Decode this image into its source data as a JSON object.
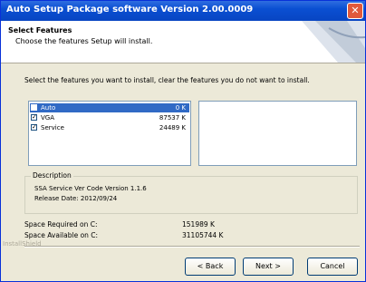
{
  "window": {
    "title": "Auto Setup Package software Version 2.00.0009"
  },
  "header": {
    "title": "Select Features",
    "subtitle": "Choose the features Setup will install."
  },
  "instructions": "Select the features you want to install, clear the features you do not want to install.",
  "features": [
    {
      "label": "Auto",
      "size": "0 K",
      "checked": false,
      "selected": true
    },
    {
      "label": "VGA",
      "size": "87537 K",
      "checked": true,
      "selected": false
    },
    {
      "label": "Service",
      "size": "24489 K",
      "checked": true,
      "selected": false
    }
  ],
  "description": {
    "legend": "Description",
    "line1": "SSA Service Ver Code Version 1.1.6",
    "line2": "Release Date: 2012/09/24"
  },
  "space": {
    "required_label": "Space Required on C:",
    "required_value": "151989 K",
    "available_label": "Space Available on C:",
    "available_value": "31105744 K"
  },
  "watermark": "InstallShield",
  "buttons": {
    "back": "< Back",
    "next": "Next >",
    "cancel": "Cancel"
  },
  "colors": {
    "titlebar": "#0a4fd2",
    "selection": "#316ac5",
    "close": "#e0593c"
  }
}
